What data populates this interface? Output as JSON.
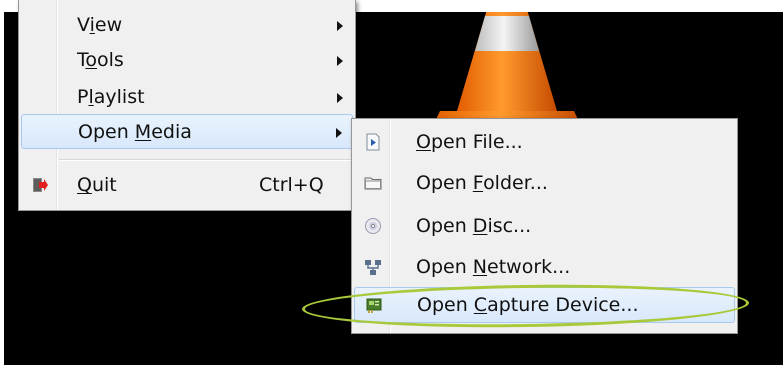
{
  "main_menu": {
    "items": [
      {
        "pre": "V",
        "ul": "i",
        "post": "ew",
        "has_submenu": true
      },
      {
        "pre": "T",
        "ul": "o",
        "post": "ols",
        "has_submenu": true
      },
      {
        "pre": "P",
        "ul": "l",
        "post": "aylist",
        "has_submenu": true
      },
      {
        "pre": "Open ",
        "ul": "M",
        "post": "edia",
        "has_submenu": true
      },
      {
        "pre": "",
        "ul": "Q",
        "post": "uit",
        "shortcut": "Ctrl+Q"
      }
    ]
  },
  "submenu": {
    "items": [
      {
        "pre": "",
        "ul": "O",
        "post": "pen File...",
        "icon": "file-icon"
      },
      {
        "pre": "Open ",
        "ul": "F",
        "post": "older...",
        "icon": "folder-icon"
      },
      {
        "pre": "Open ",
        "ul": "D",
        "post": "isc...",
        "icon": "disc-icon"
      },
      {
        "pre": "Open ",
        "ul": "N",
        "post": "etwork...",
        "icon": "network-icon"
      },
      {
        "pre": "Open ",
        "ul": "C",
        "post": "apture Device...",
        "icon": "capture-card-icon"
      }
    ]
  },
  "colors": {
    "highlight_ring": "#a9c93a",
    "menu_bg": "#f0f0f0",
    "video_bg": "#000000"
  }
}
